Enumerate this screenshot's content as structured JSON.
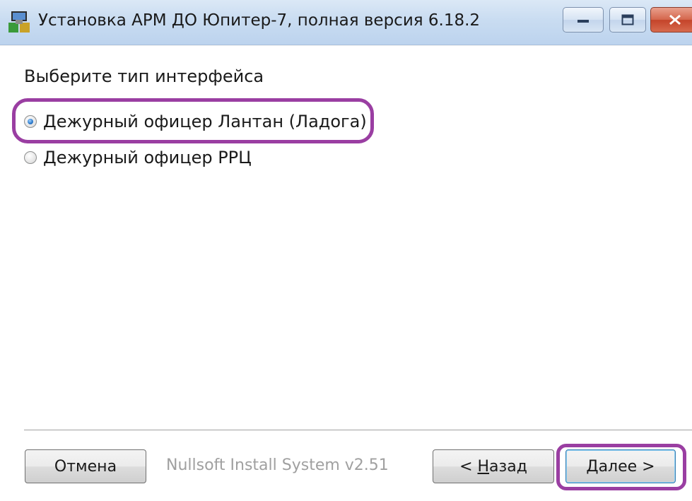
{
  "window": {
    "title": "Установка АРМ ДО Юпитер-7, полная версия 6.18.2",
    "app_icon": "installer-icon",
    "controls": {
      "minimize": "minimize-icon",
      "maximize": "maximize-icon",
      "close": "close-icon"
    }
  },
  "page": {
    "heading": "Выберите тип интерфейса",
    "options": [
      {
        "label": "Дежурный офицер Лантан (Ладога)",
        "selected": true
      },
      {
        "label": "Дежурный офицер РРЦ",
        "selected": false
      }
    ]
  },
  "footer": {
    "cancel_label": "Отмена",
    "branding": "Nullsoft Install System v2.51",
    "back_prefix": "< ",
    "back_mnemonic": "Н",
    "back_rest": "азад",
    "next_label": "Далее >"
  },
  "colors": {
    "annotation": "#9a3ea2",
    "titlebar": "#c9dcf1",
    "selected_radio": "#2a78c9"
  }
}
